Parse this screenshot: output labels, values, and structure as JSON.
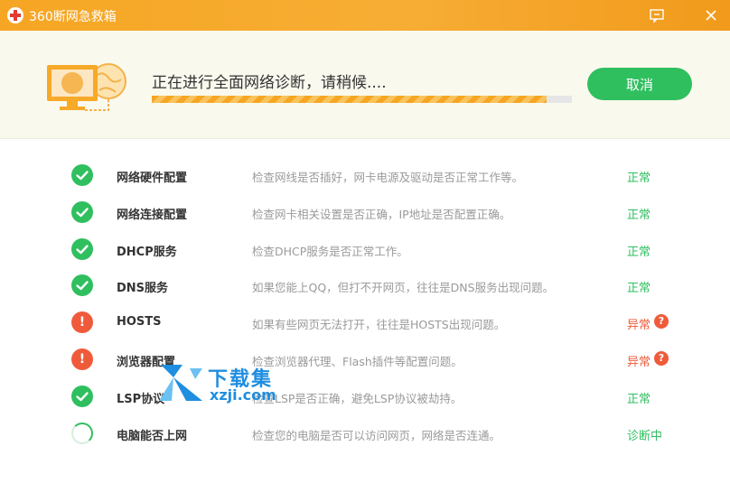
{
  "window": {
    "title": "360断网急救箱",
    "icons": {
      "logo": "red-cross-logo-icon",
      "feedback": "feedback-icon",
      "close": "close-icon"
    }
  },
  "header": {
    "status_text": "正在进行全面网络诊断，请稍候....",
    "progress": 0.94,
    "cancel_label": "取消",
    "illustration": "monitor-globe-icon"
  },
  "checks": [
    {
      "name": "网络硬件配置",
      "description": "检查网线是否插好，网卡电源及驱动是否正常工作等。",
      "status": "ok",
      "result": "正常"
    },
    {
      "name": "网络连接配置",
      "description": "检查网卡相关设置是否正确，IP地址是否配置正确。",
      "status": "ok",
      "result": "正常"
    },
    {
      "name": "DHCP服务",
      "description": "检查DHCP服务是否正常工作。",
      "status": "ok",
      "result": "正常"
    },
    {
      "name": "DNS服务",
      "description": "如果您能上QQ，但打不开网页，往往是DNS服务出现问题。",
      "status": "ok",
      "result": "正常"
    },
    {
      "name": "HOSTS",
      "description": "如果有些网页无法打开，往往是HOSTS出现问题。",
      "status": "err",
      "result": "异常"
    },
    {
      "name": "浏览器配置",
      "description": "检查浏览器代理、Flash插件等配置问题。",
      "status": "err",
      "result": "异常"
    },
    {
      "name": "LSP协议",
      "description": "检查LSP是否正确，避免LSP协议被劫持。",
      "status": "ok",
      "result": "正常"
    },
    {
      "name": "电脑能否上网",
      "description": "检查您的电脑是否可以访问网页，网络是否连通。",
      "status": "loading",
      "result": "诊断中"
    }
  ],
  "watermark": {
    "cn": "下载集",
    "en": "xzji.com"
  },
  "colors": {
    "accent_orange": "#f6a623",
    "ok_green": "#2fbf5f",
    "error_red": "#ef5b3a"
  }
}
